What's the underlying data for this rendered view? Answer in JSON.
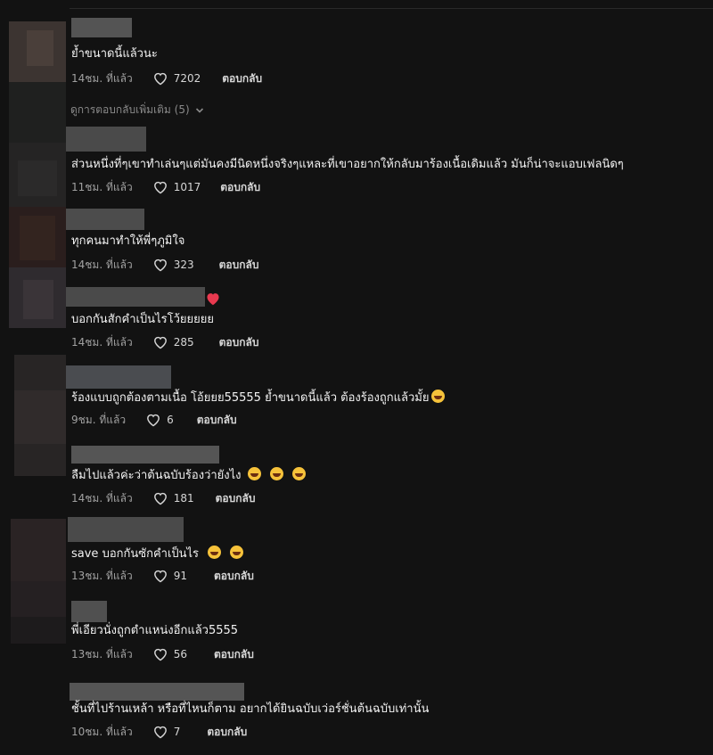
{
  "comments": [
    {
      "text": "ย้ำขนาดนี้แล้วนะ",
      "time": "14ชม. ที่แล้ว",
      "likes": "7202",
      "reply": "ตอบกลับ"
    },
    {
      "text": "ส่วนหนึ่งที่ๆเขาทำเล่นๆแต่มันคงมีนิดหนึ่งจริงๆแหละที่เขาอยากให้กลับมาร้องเนื้อเดิมแล้ว มันก็น่าจะแอบเฟลนิดๆ",
      "time": "11ชม. ที่แล้ว",
      "likes": "1017",
      "reply": "ตอบกลับ"
    },
    {
      "text": "ทุกคนมาทำให้พี่ๆภูมิใจ",
      "time": "14ชม. ที่แล้ว",
      "likes": "323",
      "reply": "ตอบกลับ"
    },
    {
      "text": "บอกกันสักคำเป็นไรโว้ยยยยย",
      "time": "14ชม. ที่แล้ว",
      "likes": "285",
      "reply": "ตอบกลับ"
    },
    {
      "text": "ร้องแบบถูกต้องตามเนื้อ โอ้ยยย55555 ย้ำขนาดนี้แล้ว ต้องร้องถูกแล้วมั้ย",
      "time": "9ชม. ที่แล้ว",
      "likes": "6",
      "reply": "ตอบกลับ"
    },
    {
      "text": "ลืมไปแล้วค่ะว่าต้นฉบับร้องว่ายังไง",
      "time": "14ชม. ที่แล้ว",
      "likes": "181",
      "reply": "ตอบกลับ"
    },
    {
      "text": "save บอกกันซักคำเป็นไร",
      "time": "13ชม. ที่แล้ว",
      "likes": "91",
      "reply": "ตอบกลับ"
    },
    {
      "text": "พี่เอียวนั่งถูกตำแหน่งอีกแล้ว5555",
      "time": "13ชม. ที่แล้ว",
      "likes": "56",
      "reply": "ตอบกลับ"
    },
    {
      "text": "ชั้นที่ไปร้านเหล้า หรือที่ไหนก็ตาม อยากได้ยินฉบับเว่อร์ชั่นต้นฉบับเท่านั้น",
      "time": "10ชม. ที่แล้ว",
      "likes": "7",
      "reply": "ตอบกลับ"
    }
  ],
  "view_more_replies": "ดูการตอบกลับเพิ่มเติม (5)",
  "icons": {
    "like": "heart-outline-icon",
    "expand": "chevron-down-icon",
    "emoji": "laughing-emoji-icon",
    "name_emoji": "red-heart-icon"
  },
  "colors": {
    "background": "#121212",
    "text": "#f2f2f2",
    "muted": "#a0a0a0"
  }
}
